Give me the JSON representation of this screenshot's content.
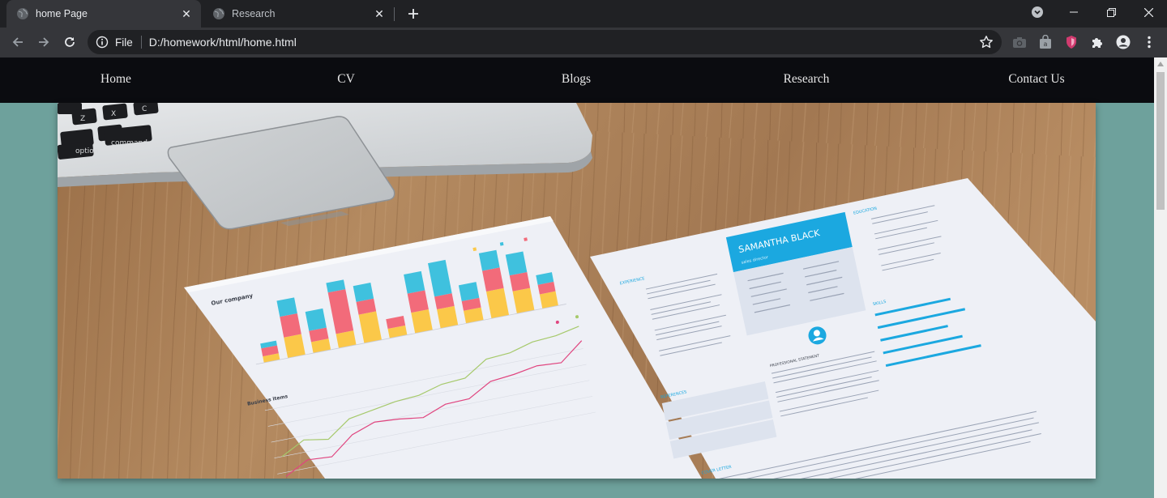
{
  "tabs": [
    {
      "title": "home Page",
      "active": true
    },
    {
      "title": "Research",
      "active": false
    }
  ],
  "omnibox": {
    "scheme_label": "File",
    "url": "D:/homework/html/home.html"
  },
  "navbar": {
    "links": [
      {
        "label": "Home"
      },
      {
        "label": "CV"
      },
      {
        "label": "Blogs"
      },
      {
        "label": "Research"
      },
      {
        "label": "Contact Us"
      }
    ]
  },
  "hero": {
    "resume_name": "SAMANTHA BLACK",
    "resume_subtitle": "sales director",
    "doc_title_left": "Our company",
    "doc_title_left2": "Business items",
    "resume_sections": [
      "EXPERIENCE",
      "EDUCATION",
      "SKILLS",
      "REFERENCES",
      "COVER LETTER",
      "PROFESSIONAL STATEMENT"
    ],
    "colors": {
      "wood": "#a87d55",
      "bar_blue": "#3fc1de",
      "bar_red": "#f26b7a",
      "bar_yellow": "#fbc849",
      "resume_accent": "#1ba8e0",
      "line_green": "#a6c96b",
      "line_pink": "#e0457f"
    }
  },
  "theme": {
    "page_bg": "#6ea19c",
    "navbar_bg": "#0b0c10",
    "chrome_bg": "#202124",
    "toolbar_bg": "#35363a"
  }
}
